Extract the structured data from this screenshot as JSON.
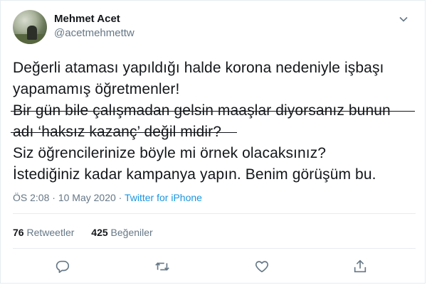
{
  "user": {
    "name": "Mehmet Acet",
    "handle": "@acetmehmettw"
  },
  "tweet": {
    "lines": [
      "Değerli ataması yapıldığı halde korona nedeniyle işbaşı",
      "yapamamış öğretmenler!",
      "Bir gün bile çalışmadan gelsin maaşlar diyorsanız bunun",
      "adı ‘haksız kazanç’ değil midir?",
      "Siz öğrencilerinize böyle mi örnek olacaksınız?",
      "İstediğiniz kadar kampanya yapın. Benim görüşüm bu."
    ]
  },
  "meta": {
    "time": "ÖS 2:08",
    "separator1": "·",
    "date": "10 May 2020",
    "separator2": "·",
    "source": "Twitter for iPhone"
  },
  "stats": {
    "retweets_count": "76",
    "retweets_label": "Retweetler",
    "likes_count": "425",
    "likes_label": "Beğeniler"
  },
  "colors": {
    "text": "#14171a",
    "secondary": "#657786",
    "link": "#1b95e0",
    "border": "#e6ecf0"
  },
  "icons": [
    "chevron-down-icon",
    "reply-icon",
    "retweet-icon",
    "like-icon",
    "share-icon"
  ]
}
